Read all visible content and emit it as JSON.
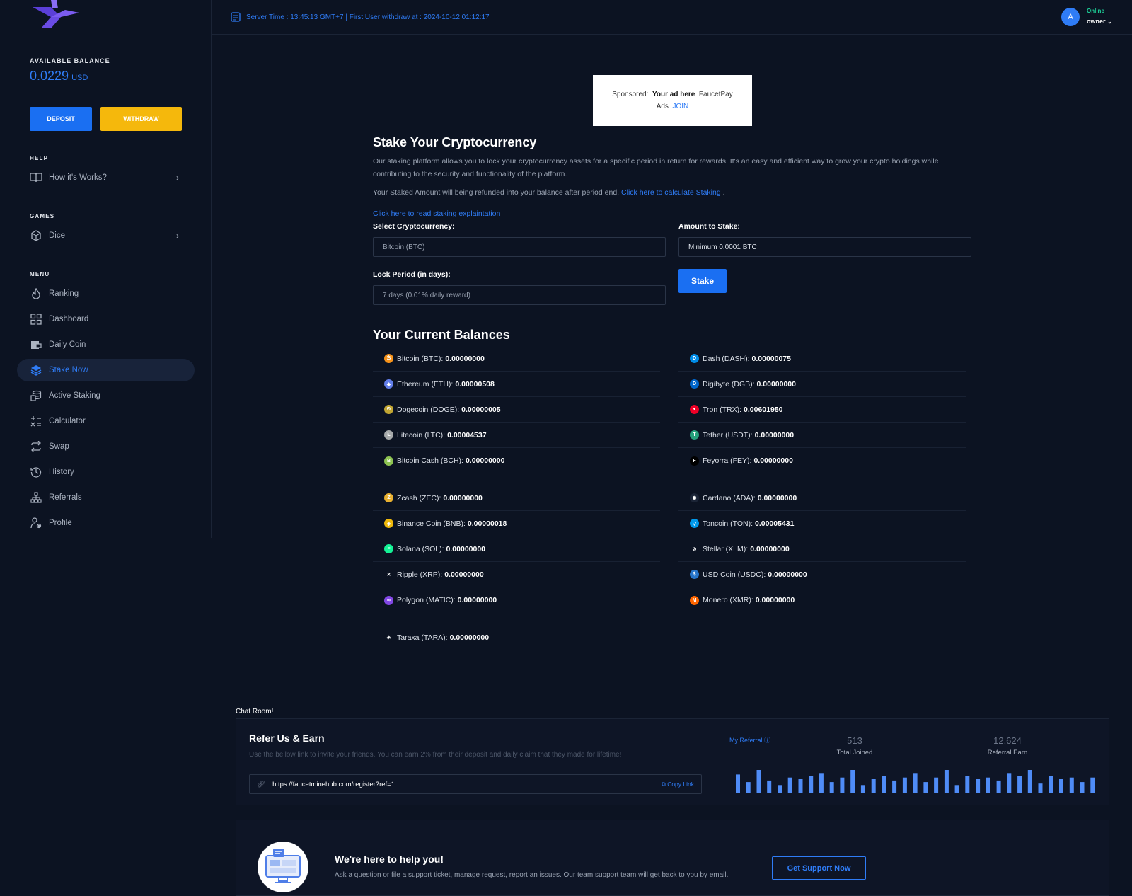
{
  "sidebar": {
    "balance_label": "AVAILABLE BALANCE",
    "balance_value": "0.0229",
    "balance_unit": "USD",
    "deposit_label": "DEPOSIT",
    "withdraw_label": "WITHDRAW",
    "help_label": "HELP",
    "games_label": "GAMES",
    "menu_label": "MENU",
    "help_items": [
      {
        "label": "How it's Works?",
        "icon": "book-icon"
      }
    ],
    "game_items": [
      {
        "label": "Dice",
        "icon": "cube-icon"
      }
    ],
    "menu_items": [
      {
        "label": "Ranking",
        "icon": "flame-icon"
      },
      {
        "label": "Dashboard",
        "icon": "grid-icon"
      },
      {
        "label": "Daily Coin",
        "icon": "wallet-icon"
      },
      {
        "label": "Stake Now",
        "icon": "layers-icon",
        "active": true
      },
      {
        "label": "Active Staking",
        "icon": "coins-icon"
      },
      {
        "label": "Calculator",
        "icon": "calculator-icon"
      },
      {
        "label": "Swap",
        "icon": "swap-icon"
      },
      {
        "label": "History",
        "icon": "history-icon"
      },
      {
        "label": "Referrals",
        "icon": "sitemap-icon"
      },
      {
        "label": "Profile",
        "icon": "user-icon"
      }
    ]
  },
  "topbar": {
    "server_text": "Server Time : 13:45:13 GMT+7 | First User withdraw at : 2024-10-12 01:12:17",
    "user_initial": "A",
    "user_status": "Online",
    "user_name": "owner"
  },
  "ad": {
    "sponsored": "Sponsored:",
    "headline": "Your ad here",
    "brand": "FaucetPay",
    "ads": "Ads",
    "join": "JOIN"
  },
  "stake": {
    "title": "Stake Your Cryptocurrency",
    "description": "Our staking platform allows you to lock your cryptocurrency assets for a specific period in return for rewards. It's an easy and efficient way to grow your crypto holdings while contributing to the security and functionality of the platform.",
    "refund_text": "Your Staked Amount will being refunded into your balance after period end,",
    "refund_link": "Click here to calculate Staking",
    "refund_end": ".",
    "explanation_link": "Click here to read staking explaintation",
    "select_label": "Select Cryptocurrency:",
    "select_value": "Bitcoin (BTC)",
    "amount_label": "Amount to Stake:",
    "amount_placeholder": "Minimum 0.0001 BTC",
    "lock_label": "Lock Period (in days):",
    "lock_value": "7 days (0.01% daily reward)",
    "stake_button": "Stake"
  },
  "balances": {
    "title": "Your Current Balances",
    "left": [
      {
        "name": "Bitcoin (BTC):",
        "amount": "0.00000000",
        "color": "#f7931a",
        "glyph": "₿"
      },
      {
        "name": "Ethereum (ETH):",
        "amount": "0.00000508",
        "color": "#627eea",
        "glyph": "◆"
      },
      {
        "name": "Dogecoin (DOGE):",
        "amount": "0.00000005",
        "color": "#c2a633",
        "glyph": "Ð"
      },
      {
        "name": "Litecoin (LTC):",
        "amount": "0.00004537",
        "color": "#a6a9aa",
        "glyph": "Ł"
      },
      {
        "name": "Bitcoin Cash (BCH):",
        "amount": "0.00000000",
        "color": "#8dc351",
        "glyph": "B"
      },
      {
        "name": "Zcash (ZEC):",
        "amount": "0.00000000",
        "color": "#e8b030",
        "glyph": "Z"
      },
      {
        "name": "Binance Coin (BNB):",
        "amount": "0.00000018",
        "color": "#f0b90b",
        "glyph": "◈"
      },
      {
        "name": "Solana (SOL):",
        "amount": "0.00000000",
        "color": "#14f195",
        "glyph": "≡"
      },
      {
        "name": "Ripple (XRP):",
        "amount": "0.00000000",
        "color": "#0c1322",
        "glyph": "✕"
      },
      {
        "name": "Polygon (MATIC):",
        "amount": "0.00000000",
        "color": "#8247e5",
        "glyph": "∞"
      },
      {
        "name": "Taraxa (TARA):",
        "amount": "0.00000000",
        "color": "#0c1322",
        "glyph": "✳"
      }
    ],
    "right": [
      {
        "name": "Dash (DASH):",
        "amount": "0.00000075",
        "color": "#008ce7",
        "glyph": "D"
      },
      {
        "name": "Digibyte (DGB):",
        "amount": "0.00000000",
        "color": "#0066cc",
        "glyph": "D"
      },
      {
        "name": "Tron (TRX):",
        "amount": "0.00601950",
        "color": "#ef0027",
        "glyph": "▼"
      },
      {
        "name": "Tether (USDT):",
        "amount": "0.00000000",
        "color": "#26a17b",
        "glyph": "T"
      },
      {
        "name": "Feyorra (FEY):",
        "amount": "0.00000000",
        "color": "#000000",
        "glyph": "F"
      },
      {
        "name": "Cardano (ADA):",
        "amount": "0.00000000",
        "color": "#1b2436",
        "glyph": "✺"
      },
      {
        "name": "Toncoin (TON):",
        "amount": "0.00005431",
        "color": "#0098ea",
        "glyph": "▽"
      },
      {
        "name": "Stellar (XLM):",
        "amount": "0.00000000",
        "color": "#0c1322",
        "glyph": "⊘"
      },
      {
        "name": "USD Coin (USDC):",
        "amount": "0.00000000",
        "color": "#2775ca",
        "glyph": "$"
      },
      {
        "name": "Monero (XMR):",
        "amount": "0.00000000",
        "color": "#ff6600",
        "glyph": "M"
      }
    ]
  },
  "chat": {
    "label": "Chat Room!"
  },
  "refer": {
    "title": "Refer Us & Earn",
    "description": "Use the bellow link to invite your friends. You can earn 2% from their deposit and daily claim that they made for lifetime!",
    "link": "https://faucetminehub.com/register?ref=1",
    "copy_label": "Copy Link",
    "my_referral": "My Referral",
    "total_joined_value": "513",
    "total_joined_label": "Total Joined",
    "referral_earn_value": "12,624",
    "referral_earn_label": "Referral Earn",
    "bar_values": [
      24,
      14,
      30,
      16,
      10,
      20,
      18,
      22,
      26,
      14,
      20,
      30,
      10,
      18,
      22,
      16,
      20,
      26,
      14,
      20,
      30,
      10,
      22,
      18,
      20,
      16,
      26,
      22,
      30,
      12,
      22,
      18,
      20,
      14,
      20
    ]
  },
  "support": {
    "title": "We're here to help you!",
    "description": "Ask a question or file a support ticket, manage request, report an issues. Our team support team will get back to you by email.",
    "button": "Get Support Now"
  },
  "colors": {
    "background": "#0c1322",
    "accent": "#2f7cf6",
    "deposit": "#1a6ff2",
    "withdraw": "#f5b80c",
    "online": "#1dd39a"
  }
}
